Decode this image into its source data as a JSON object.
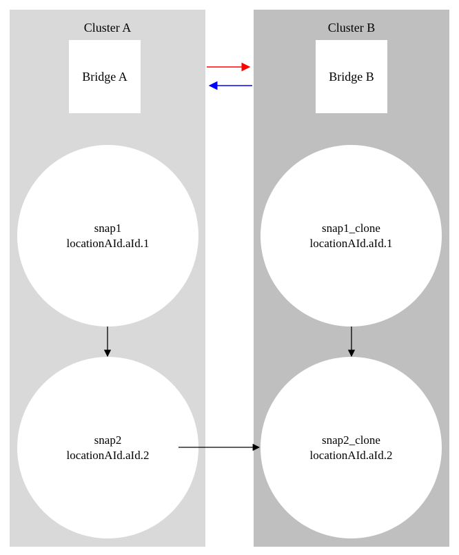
{
  "clusters": {
    "a": {
      "title": "Cluster A"
    },
    "b": {
      "title": "Cluster B"
    }
  },
  "bridges": {
    "a": {
      "label": "Bridge A"
    },
    "b": {
      "label": "Bridge B"
    }
  },
  "nodes": {
    "snap1": {
      "name": "snap1",
      "loc": "locationAId.aId.1"
    },
    "snap2": {
      "name": "snap2",
      "loc": "locationAId.aId.2"
    },
    "snap1c": {
      "name": "snap1_clone",
      "loc": "locationAId.aId.1"
    },
    "snap2c": {
      "name": "snap2_clone",
      "loc": "locationAId.aId.2"
    }
  },
  "edges": {
    "ab_red": {
      "color": "#ff0000"
    },
    "ba_blue": {
      "color": "#0000ff"
    },
    "black": {
      "color": "#000000"
    }
  }
}
